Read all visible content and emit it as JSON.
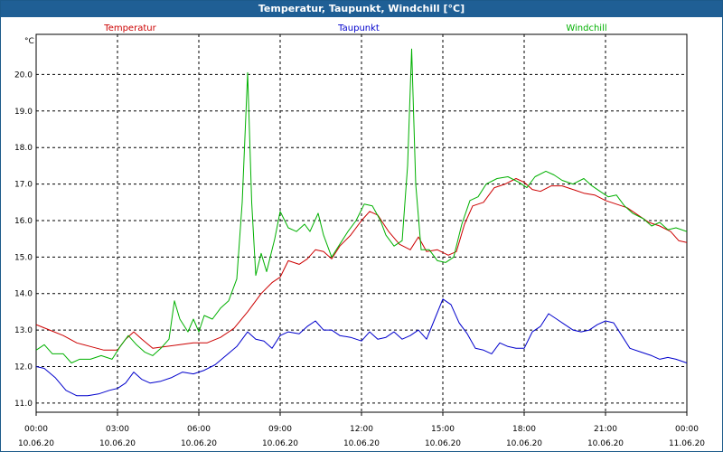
{
  "window": {
    "title": "Temperatur, Taupunkt, Windchill [°C]"
  },
  "chart_data": {
    "type": "line",
    "title": "Temperatur, Taupunkt, Windchill [°C]",
    "ylabel": "°C",
    "ylim": [
      10.75,
      21.1
    ],
    "y_ticks": [
      "11.0",
      "12.0",
      "13.0",
      "14.0",
      "15.0",
      "16.0",
      "17.0",
      "18.0",
      "19.0",
      "20.0"
    ],
    "xlim": [
      0,
      24
    ],
    "x_ticks": [
      {
        "time": "00:00",
        "date": "10.06.20"
      },
      {
        "time": "03:00",
        "date": "10.06.20"
      },
      {
        "time": "06:00",
        "date": "10.06.20"
      },
      {
        "time": "09:00",
        "date": "10.06.20"
      },
      {
        "time": "12:00",
        "date": "10.06.20"
      },
      {
        "time": "15:00",
        "date": "10.06.20"
      },
      {
        "time": "18:00",
        "date": "10.06.20"
      },
      {
        "time": "21:00",
        "date": "10.06.20"
      },
      {
        "time": "00:00",
        "date": "11.06.20"
      }
    ],
    "grid": true,
    "legend_position": "top",
    "x_unit": "hours since 10.06.20 00:00",
    "series": [
      {
        "name": "Temperatur",
        "color": "#cc0000",
        "points": [
          [
            0,
            13.15
          ],
          [
            0.5,
            13.0
          ],
          [
            1,
            12.85
          ],
          [
            1.5,
            12.65
          ],
          [
            2,
            12.55
          ],
          [
            2.5,
            12.45
          ],
          [
            3,
            12.45
          ],
          [
            3.3,
            12.75
          ],
          [
            3.6,
            12.95
          ],
          [
            3.9,
            12.75
          ],
          [
            4.3,
            12.5
          ],
          [
            4.8,
            12.55
          ],
          [
            5.3,
            12.6
          ],
          [
            5.8,
            12.65
          ],
          [
            6.3,
            12.65
          ],
          [
            6.8,
            12.8
          ],
          [
            7.3,
            13.05
          ],
          [
            7.8,
            13.5
          ],
          [
            8.3,
            14.0
          ],
          [
            8.7,
            14.3
          ],
          [
            9.0,
            14.45
          ],
          [
            9.3,
            14.9
          ],
          [
            9.7,
            14.8
          ],
          [
            10.0,
            14.95
          ],
          [
            10.3,
            15.2
          ],
          [
            10.6,
            15.15
          ],
          [
            10.9,
            14.95
          ],
          [
            11.2,
            15.3
          ],
          [
            11.6,
            15.6
          ],
          [
            12.0,
            16.0
          ],
          [
            12.3,
            16.25
          ],
          [
            12.6,
            16.15
          ],
          [
            13.0,
            15.7
          ],
          [
            13.4,
            15.35
          ],
          [
            13.8,
            15.2
          ],
          [
            14.1,
            15.55
          ],
          [
            14.4,
            15.15
          ],
          [
            14.8,
            15.2
          ],
          [
            15.2,
            15.05
          ],
          [
            15.5,
            15.15
          ],
          [
            15.8,
            15.9
          ],
          [
            16.1,
            16.4
          ],
          [
            16.5,
            16.5
          ],
          [
            16.9,
            16.9
          ],
          [
            17.3,
            17.0
          ],
          [
            17.7,
            17.15
          ],
          [
            18.0,
            17.05
          ],
          [
            18.3,
            16.85
          ],
          [
            18.6,
            16.8
          ],
          [
            19.0,
            16.95
          ],
          [
            19.4,
            16.95
          ],
          [
            19.8,
            16.85
          ],
          [
            20.2,
            16.75
          ],
          [
            20.6,
            16.7
          ],
          [
            21.0,
            16.55
          ],
          [
            21.4,
            16.45
          ],
          [
            21.8,
            16.35
          ],
          [
            22.2,
            16.15
          ],
          [
            22.6,
            15.95
          ],
          [
            23.0,
            15.85
          ],
          [
            23.4,
            15.7
          ],
          [
            23.7,
            15.45
          ],
          [
            24,
            15.4
          ]
        ]
      },
      {
        "name": "Taupunkt",
        "color": "#0000cc",
        "points": [
          [
            0,
            12.0
          ],
          [
            0.3,
            11.95
          ],
          [
            0.7,
            11.7
          ],
          [
            1.1,
            11.35
          ],
          [
            1.5,
            11.2
          ],
          [
            1.9,
            11.2
          ],
          [
            2.3,
            11.25
          ],
          [
            2.7,
            11.35
          ],
          [
            3.0,
            11.4
          ],
          [
            3.3,
            11.55
          ],
          [
            3.6,
            11.85
          ],
          [
            3.9,
            11.65
          ],
          [
            4.2,
            11.55
          ],
          [
            4.6,
            11.6
          ],
          [
            5.0,
            11.7
          ],
          [
            5.4,
            11.85
          ],
          [
            5.8,
            11.8
          ],
          [
            6.2,
            11.9
          ],
          [
            6.6,
            12.05
          ],
          [
            7.0,
            12.3
          ],
          [
            7.4,
            12.55
          ],
          [
            7.8,
            12.95
          ],
          [
            8.1,
            12.75
          ],
          [
            8.4,
            12.7
          ],
          [
            8.7,
            12.5
          ],
          [
            9.0,
            12.85
          ],
          [
            9.3,
            12.95
          ],
          [
            9.7,
            12.9
          ],
          [
            10.0,
            13.1
          ],
          [
            10.3,
            13.25
          ],
          [
            10.6,
            13.0
          ],
          [
            10.9,
            13.0
          ],
          [
            11.2,
            12.85
          ],
          [
            11.6,
            12.8
          ],
          [
            12.0,
            12.7
          ],
          [
            12.3,
            12.95
          ],
          [
            12.6,
            12.75
          ],
          [
            12.9,
            12.8
          ],
          [
            13.2,
            12.95
          ],
          [
            13.5,
            12.75
          ],
          [
            13.8,
            12.85
          ],
          [
            14.1,
            13.0
          ],
          [
            14.4,
            12.75
          ],
          [
            14.7,
            13.3
          ],
          [
            15.0,
            13.85
          ],
          [
            15.3,
            13.7
          ],
          [
            15.6,
            13.2
          ],
          [
            15.9,
            12.9
          ],
          [
            16.2,
            12.5
          ],
          [
            16.5,
            12.45
          ],
          [
            16.8,
            12.35
          ],
          [
            17.1,
            12.65
          ],
          [
            17.4,
            12.55
          ],
          [
            17.7,
            12.5
          ],
          [
            18.0,
            12.5
          ],
          [
            18.3,
            12.95
          ],
          [
            18.6,
            13.1
          ],
          [
            18.9,
            13.45
          ],
          [
            19.2,
            13.3
          ],
          [
            19.5,
            13.15
          ],
          [
            19.8,
            13.0
          ],
          [
            20.1,
            12.95
          ],
          [
            20.4,
            13.0
          ],
          [
            20.7,
            13.15
          ],
          [
            21.0,
            13.25
          ],
          [
            21.3,
            13.2
          ],
          [
            21.6,
            12.85
          ],
          [
            21.9,
            12.5
          ],
          [
            22.3,
            12.4
          ],
          [
            22.7,
            12.3
          ],
          [
            23.0,
            12.2
          ],
          [
            23.3,
            12.25
          ],
          [
            23.6,
            12.2
          ],
          [
            24,
            12.1
          ]
        ]
      },
      {
        "name": "Windchill",
        "color": "#00b000",
        "points": [
          [
            0,
            12.45
          ],
          [
            0.3,
            12.6
          ],
          [
            0.6,
            12.35
          ],
          [
            1.0,
            12.35
          ],
          [
            1.3,
            12.1
          ],
          [
            1.6,
            12.2
          ],
          [
            2.0,
            12.2
          ],
          [
            2.4,
            12.3
          ],
          [
            2.8,
            12.2
          ],
          [
            3.1,
            12.55
          ],
          [
            3.4,
            12.85
          ],
          [
            3.7,
            12.6
          ],
          [
            4.0,
            12.4
          ],
          [
            4.3,
            12.3
          ],
          [
            4.6,
            12.5
          ],
          [
            4.9,
            12.75
          ],
          [
            5.1,
            13.8
          ],
          [
            5.3,
            13.3
          ],
          [
            5.6,
            12.95
          ],
          [
            5.8,
            13.3
          ],
          [
            6.0,
            12.95
          ],
          [
            6.2,
            13.4
          ],
          [
            6.5,
            13.3
          ],
          [
            6.8,
            13.6
          ],
          [
            7.1,
            13.8
          ],
          [
            7.4,
            14.4
          ],
          [
            7.6,
            16.5
          ],
          [
            7.8,
            20.05
          ],
          [
            7.95,
            16.5
          ],
          [
            8.1,
            14.5
          ],
          [
            8.3,
            15.1
          ],
          [
            8.5,
            14.6
          ],
          [
            8.8,
            15.5
          ],
          [
            9.0,
            16.25
          ],
          [
            9.3,
            15.8
          ],
          [
            9.6,
            15.7
          ],
          [
            9.9,
            15.9
          ],
          [
            10.1,
            15.7
          ],
          [
            10.4,
            16.2
          ],
          [
            10.6,
            15.6
          ],
          [
            10.9,
            15.0
          ],
          [
            11.2,
            15.35
          ],
          [
            11.5,
            15.7
          ],
          [
            11.8,
            16.0
          ],
          [
            12.1,
            16.45
          ],
          [
            12.4,
            16.4
          ],
          [
            12.7,
            16.0
          ],
          [
            12.9,
            15.6
          ],
          [
            13.2,
            15.3
          ],
          [
            13.5,
            15.45
          ],
          [
            13.7,
            17.5
          ],
          [
            13.85,
            20.7
          ],
          [
            14.0,
            17.0
          ],
          [
            14.2,
            15.2
          ],
          [
            14.5,
            15.2
          ],
          [
            14.8,
            14.9
          ],
          [
            15.1,
            14.85
          ],
          [
            15.4,
            15.0
          ],
          [
            15.7,
            15.9
          ],
          [
            16.0,
            16.55
          ],
          [
            16.3,
            16.65
          ],
          [
            16.6,
            17.0
          ],
          [
            17.0,
            17.15
          ],
          [
            17.4,
            17.2
          ],
          [
            17.8,
            17.05
          ],
          [
            18.1,
            16.9
          ],
          [
            18.4,
            17.2
          ],
          [
            18.8,
            17.35
          ],
          [
            19.1,
            17.25
          ],
          [
            19.4,
            17.1
          ],
          [
            19.8,
            17.0
          ],
          [
            20.2,
            17.15
          ],
          [
            20.5,
            16.95
          ],
          [
            20.8,
            16.8
          ],
          [
            21.1,
            16.65
          ],
          [
            21.4,
            16.7
          ],
          [
            21.7,
            16.4
          ],
          [
            22.0,
            16.2
          ],
          [
            22.4,
            16.05
          ],
          [
            22.7,
            15.85
          ],
          [
            23.0,
            15.95
          ],
          [
            23.3,
            15.75
          ],
          [
            23.6,
            15.8
          ],
          [
            24,
            15.7
          ]
        ]
      }
    ]
  }
}
